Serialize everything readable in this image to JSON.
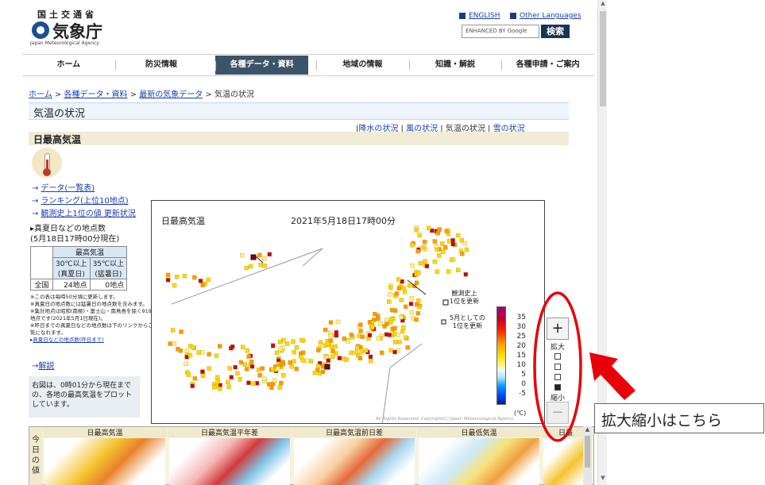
{
  "header": {
    "agency_top": "国土交通省",
    "agency_name": "気象庁",
    "agency_en": "Japan Meteorological Agency",
    "lang_english": "ENGLISH",
    "lang_other": "Other Languages",
    "search_placeholder": "ENHANCED BY Google",
    "search_button": "検索"
  },
  "nav": [
    {
      "label": "ホーム",
      "active": false
    },
    {
      "label": "防災情報",
      "active": false
    },
    {
      "label": "各種データ・資料",
      "active": true
    },
    {
      "label": "地域の情報",
      "active": false
    },
    {
      "label": "知識・解説",
      "active": false
    },
    {
      "label": "各種申請・ご案内",
      "active": false
    }
  ],
  "breadcrumb": {
    "items": [
      "ホーム",
      "各種データ・資料",
      "最新の気象データ"
    ],
    "separator": " > ",
    "current": "気温の状況"
  },
  "page_title": "気温の状況",
  "subnav": {
    "items": [
      "降水の状況",
      "風の状況",
      "気温の状況",
      "雪の状況"
    ],
    "current_index": 2
  },
  "section_title": "日最高気温",
  "side_links": [
    "データ(一覧表)",
    "ランキング(上位10地点)",
    "観測史上1位の値 更新状況"
  ],
  "counts": {
    "title_line1": "▸真夏日などの地点数",
    "title_line2": "(5月18日17時00分現在)",
    "header_group": "最高気温",
    "col1_line1": "30℃以上",
    "col1_line2": "(真夏日)",
    "col2_line1": "35℃以上",
    "col2_line2": "(猛暑日)",
    "row_label": "全国",
    "value1": "24地点",
    "value2": "0地点"
  },
  "notes": {
    "n1": "※この表は毎時50分頃に更新します。",
    "n2": "※真夏日の地点数には猛暑日の地点数を含みます。",
    "n3": "※集計地点は昭和(南極)・富士山・南鳥島を除く919地点です(2021年5月1日現在)。",
    "n4": "※昨日までの真夏日などの地点数は下のリンクからご覧になれます。",
    "link": "真夏日などの地点数(昨日まで)"
  },
  "commentary_link": "解説",
  "description": "右図は、0時01分から現在までの、各地の最高気温をプロットしています。",
  "map": {
    "title": "日最高気温",
    "timestamp": "2021年5月18日17時00分",
    "legend_unit": "(℃)",
    "legend_values": [
      "35",
      "30",
      "25",
      "20",
      "15",
      "10",
      "5",
      "0",
      "-5"
    ],
    "record_label_line1": "観測史上",
    "record_label_line2": "1位を更新",
    "may_label_line1": "5月としての",
    "may_label_line2": "1位を更新",
    "copyright": "All Rights Reserved, Copyright(C) Japan Meteorological Agency",
    "colors": {
      "hot": "#c1002a",
      "warm": "#ff9900",
      "mild": "#ffd700",
      "cool": "#fff380"
    }
  },
  "zoom": {
    "plus": "+",
    "minus": "−",
    "zoom_in_label": "拡大",
    "zoom_out_label": "縮小",
    "levels": 4,
    "current_level": 4
  },
  "thumbnails": {
    "side_label": "今日の値",
    "items": [
      "日最高気温",
      "日最高気温平年差",
      "日最高気温前日差",
      "日最低気温",
      "日最"
    ]
  },
  "annotation": {
    "callout_text": "拡大縮小はこちら",
    "highlight_color": "#e8000b"
  }
}
